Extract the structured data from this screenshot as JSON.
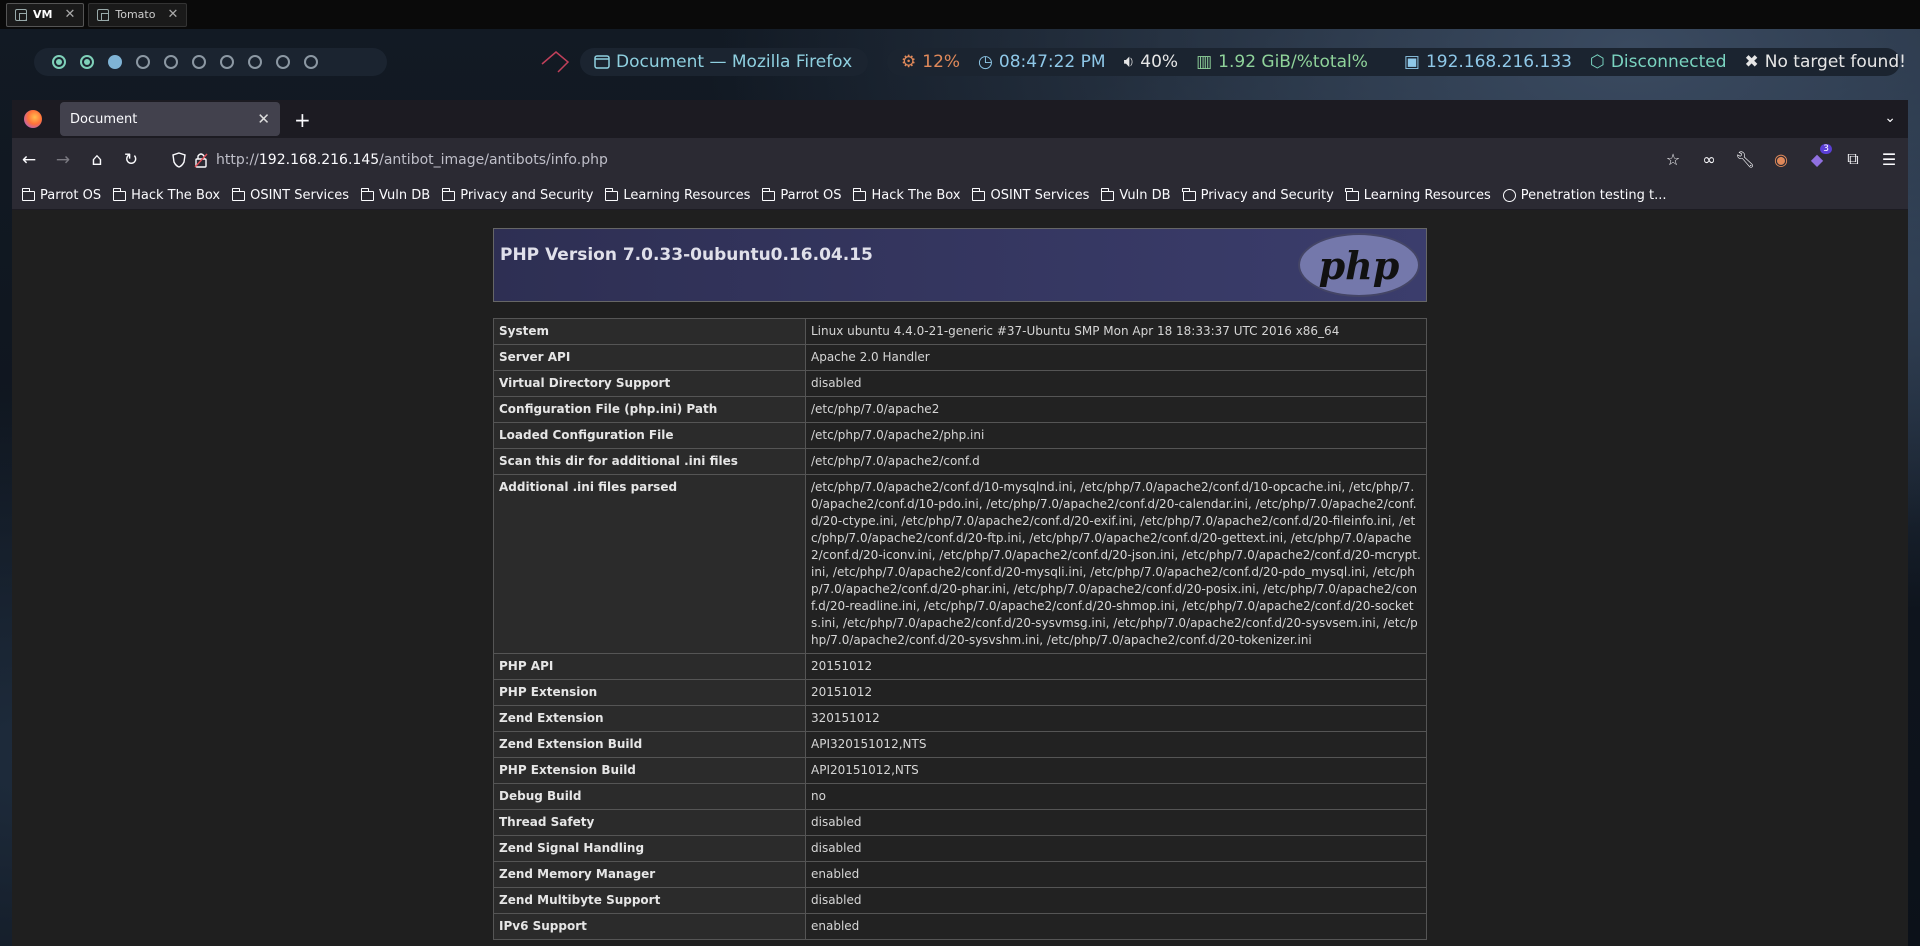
{
  "host_tabs": [
    {
      "label": "VM",
      "active": true
    },
    {
      "label": "Tomato",
      "active": false
    }
  ],
  "panel": {
    "workspaces": [
      "occupied",
      "occupied",
      "current",
      "empty",
      "empty",
      "empty",
      "empty",
      "empty",
      "empty",
      "empty"
    ],
    "window_title": "Document — Mozilla Firefox",
    "cpu": "12%",
    "clock": "08:47:22 PM",
    "volume": "40%",
    "memory": "1.92 GiB/%total%",
    "ip": "192.168.216.133",
    "vpn": "Disconnected",
    "target": "No target found!"
  },
  "browser": {
    "tab_title": "Document",
    "url_proto": "http://",
    "url_host": "192.168.216.145",
    "url_path": "/antibot_image/antibots/info.php",
    "bookmarks": [
      {
        "type": "folder",
        "label": "Parrot OS"
      },
      {
        "type": "folder",
        "label": "Hack The Box"
      },
      {
        "type": "folder",
        "label": "OSINT Services"
      },
      {
        "type": "folder",
        "label": "Vuln DB"
      },
      {
        "type": "folder",
        "label": "Privacy and Security"
      },
      {
        "type": "folder",
        "label": "Learning Resources"
      },
      {
        "type": "folder",
        "label": "Parrot OS"
      },
      {
        "type": "folder",
        "label": "Hack The Box"
      },
      {
        "type": "folder",
        "label": "OSINT Services"
      },
      {
        "type": "folder",
        "label": "Vuln DB"
      },
      {
        "type": "folder",
        "label": "Privacy and Security"
      },
      {
        "type": "folder",
        "label": "Learning Resources"
      },
      {
        "type": "link",
        "label": "Penetration testing t..."
      }
    ],
    "addon_badge": "3"
  },
  "phpinfo": {
    "title": "PHP Version 7.0.33-0ubuntu0.16.04.15",
    "logo_text": "php",
    "rows": [
      [
        "System",
        "Linux ubuntu 4.4.0-21-generic #37-Ubuntu SMP Mon Apr 18 18:33:37 UTC 2016 x86_64"
      ],
      [
        "Server API",
        "Apache 2.0 Handler"
      ],
      [
        "Virtual Directory Support",
        "disabled"
      ],
      [
        "Configuration File (php.ini) Path",
        "/etc/php/7.0/apache2"
      ],
      [
        "Loaded Configuration File",
        "/etc/php/7.0/apache2/php.ini"
      ],
      [
        "Scan this dir for additional .ini files",
        "/etc/php/7.0/apache2/conf.d"
      ],
      [
        "Additional .ini files parsed",
        "/etc/php/7.0/apache2/conf.d/10-mysqlnd.ini, /etc/php/7.0/apache2/conf.d/10-opcache.ini, /etc/php/7.0/apache2/conf.d/10-pdo.ini, /etc/php/7.0/apache2/conf.d/20-calendar.ini, /etc/php/7.0/apache2/conf.d/20-ctype.ini, /etc/php/7.0/apache2/conf.d/20-exif.ini, /etc/php/7.0/apache2/conf.d/20-fileinfo.ini, /etc/php/7.0/apache2/conf.d/20-ftp.ini, /etc/php/7.0/apache2/conf.d/20-gettext.ini, /etc/php/7.0/apache2/conf.d/20-iconv.ini, /etc/php/7.0/apache2/conf.d/20-json.ini, /etc/php/7.0/apache2/conf.d/20-mcrypt.ini, /etc/php/7.0/apache2/conf.d/20-mysqli.ini, /etc/php/7.0/apache2/conf.d/20-pdo_mysql.ini, /etc/php/7.0/apache2/conf.d/20-phar.ini, /etc/php/7.0/apache2/conf.d/20-posix.ini, /etc/php/7.0/apache2/conf.d/20-readline.ini, /etc/php/7.0/apache2/conf.d/20-shmop.ini, /etc/php/7.0/apache2/conf.d/20-sockets.ini, /etc/php/7.0/apache2/conf.d/20-sysvmsg.ini, /etc/php/7.0/apache2/conf.d/20-sysvsem.ini, /etc/php/7.0/apache2/conf.d/20-sysvshm.ini, /etc/php/7.0/apache2/conf.d/20-tokenizer.ini"
      ],
      [
        "PHP API",
        "20151012"
      ],
      [
        "PHP Extension",
        "20151012"
      ],
      [
        "Zend Extension",
        "320151012"
      ],
      [
        "Zend Extension Build",
        "API320151012,NTS"
      ],
      [
        "PHP Extension Build",
        "API20151012,NTS"
      ],
      [
        "Debug Build",
        "no"
      ],
      [
        "Thread Safety",
        "disabled"
      ],
      [
        "Zend Signal Handling",
        "disabled"
      ],
      [
        "Zend Memory Manager",
        "enabled"
      ],
      [
        "Zend Multibyte Support",
        "disabled"
      ],
      [
        "IPv6 Support",
        "enabled"
      ]
    ]
  },
  "colors": {
    "accent_teal": "#7ad4c0",
    "accent_orange": "#e0895a",
    "php_header": "#3b3d6c"
  }
}
